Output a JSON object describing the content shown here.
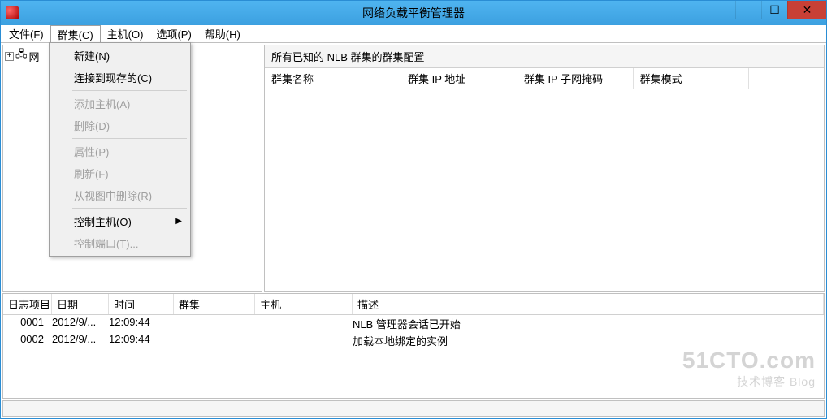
{
  "window": {
    "title": "网络负载平衡管理器"
  },
  "menubar": {
    "file": "文件(F)",
    "cluster": "群集(C)",
    "host": "主机(O)",
    "options": "选项(P)",
    "help": "帮助(H)"
  },
  "dropdown": {
    "new": "新建(N)",
    "connect": "连接到现存的(C)",
    "addhost": "添加主机(A)",
    "delete": "删除(D)",
    "properties": "属性(P)",
    "refresh": "刷新(F)",
    "removeview": "从视图中删除(R)",
    "controlhost": "控制主机(O)",
    "controlport": "控制端口(T)..."
  },
  "tree": {
    "root": "网"
  },
  "listheader": "所有已知的 NLB 群集的群集配置",
  "columns": {
    "name": "群集名称",
    "ip": "群集 IP 地址",
    "mask": "群集 IP 子网掩码",
    "mode": "群集模式"
  },
  "logcols": {
    "item": "日志项目",
    "date": "日期",
    "time": "时间",
    "cluster": "群集",
    "host": "主机",
    "desc": "描述"
  },
  "logrows": [
    {
      "id": "0001",
      "date": "2012/9/...",
      "time": "12:09:44",
      "cluster": "",
      "host": "",
      "desc": "NLB 管理器会话已开始"
    },
    {
      "id": "0002",
      "date": "2012/9/...",
      "time": "12:09:44",
      "cluster": "",
      "host": "",
      "desc": "加载本地绑定的实例"
    }
  ],
  "watermark": {
    "big": "51CTO.com",
    "small": "技术博客  Blog"
  }
}
